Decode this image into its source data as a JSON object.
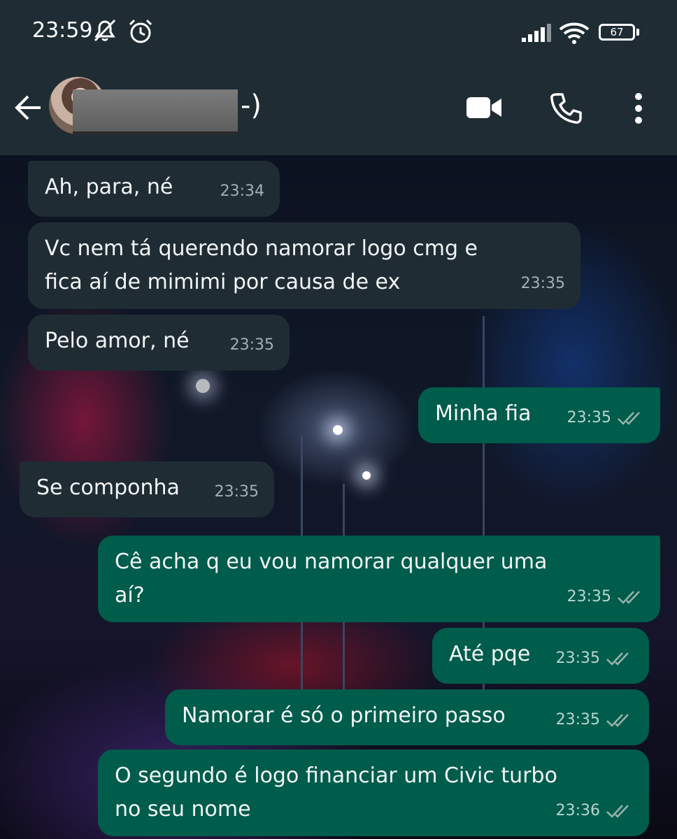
{
  "status_bar": {
    "time": "23:59",
    "battery": "67",
    "icons": [
      "mute-icon",
      "alarm-icon",
      "signal-icon",
      "wifi-icon",
      "battery-icon"
    ]
  },
  "header": {
    "contact_name_visible": "-)",
    "icons": [
      "back-arrow-icon",
      "video-call-icon",
      "phone-icon",
      "more-options-icon"
    ]
  },
  "colors": {
    "header_bg": "#1f2c34",
    "incoming_bubble": "#1f2c34",
    "outgoing_bubble": "#005c4b",
    "read_ticks": "#9ab3ad"
  },
  "messages": [
    {
      "direction": "incoming",
      "text": "Ah, para, né",
      "time": "23:34"
    },
    {
      "direction": "incoming",
      "text": "Vc nem tá querendo namorar logo cmg e\nfica aí de mimimi por causa de ex",
      "time": "23:35"
    },
    {
      "direction": "incoming",
      "text": "Pelo amor, né",
      "time": "23:35"
    },
    {
      "direction": "outgoing",
      "text": "Minha fia",
      "time": "23:35",
      "status": "read"
    },
    {
      "direction": "incoming",
      "text": "Se componha",
      "time": "23:35"
    },
    {
      "direction": "outgoing",
      "text": "Cê acha q eu vou namorar qualquer uma\naí?",
      "time": "23:35",
      "status": "read"
    },
    {
      "direction": "outgoing",
      "text": "Até pqe",
      "time": "23:35",
      "status": "read"
    },
    {
      "direction": "outgoing",
      "text": "Namorar é só o primeiro passo",
      "time": "23:35",
      "status": "read"
    },
    {
      "direction": "outgoing",
      "text": "O segundo é logo financiar um Civic turbo\nno seu nome",
      "time": "23:36",
      "status": "read"
    }
  ]
}
